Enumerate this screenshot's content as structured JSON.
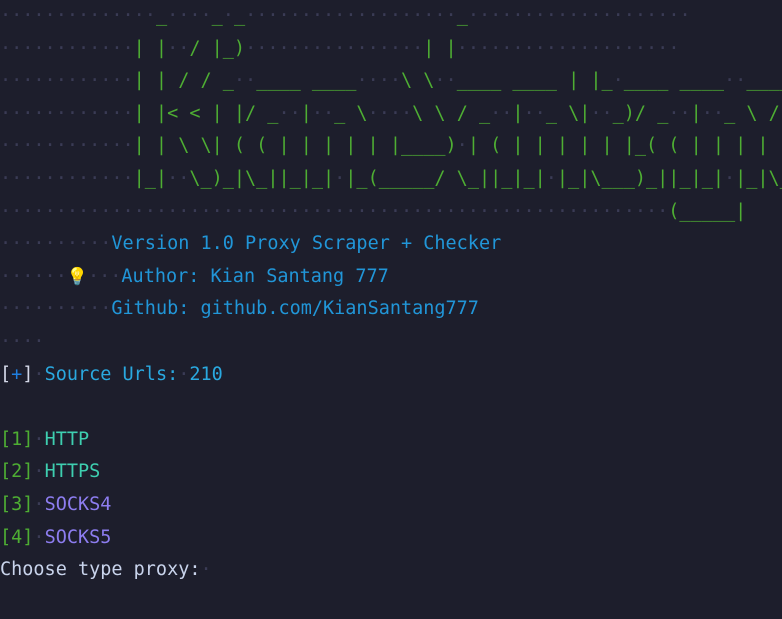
{
  "terminal": {
    "background_color": "#1d1e2c",
    "whitespace_dot_color": "#3a3b55",
    "ascii_art_color": "#4eae33",
    "info_color": "#2196d8",
    "banner": {
      "name": "Kr Proxy Scraper figlet banner",
      "rows": [
        "               _      _ _                    _",
        "              | |  / |_)                    | |",
        "              | | / / _  ____ ____    \\ \\  ____ ____ | |_  ____ ____   ____",
        "              | |< < | |/ _  |  _ \\    \\ \\ / _  |  _ \\|  _)/ _  |  _ \\ / _  |",
        "              | | \\ \\| ( ( | | | | |____) | ( | | | | | |_( ( | | | | ( ( | |",
        "              |_|  \\_)_|\\_||_|_| |_(_____/ \\_||_|_| |_|\\___)_||_|_| |_|\\_|| |",
        "                                                                   (_____|"
      ]
    },
    "lines": [
      {
        "id": "version",
        "indent": 12,
        "text": "Version 1.0 Proxy Scraper + Checker",
        "color": "info"
      },
      {
        "id": "author",
        "indent": 12,
        "text": "Author: Kian Santang 777",
        "color": "info",
        "emoji": "💡",
        "emoji_name": "lightbulb-icon"
      },
      {
        "id": "github",
        "indent": 12,
        "text": "Github: github.com/KianSantang777",
        "color": "info"
      }
    ],
    "source_urls": {
      "bracket_open": "[",
      "marker": "+",
      "bracket_close": "]",
      "label": "Source Urls:",
      "count": "210"
    },
    "menu": {
      "items": [
        {
          "key": "1",
          "label": "HTTP",
          "color": "teal"
        },
        {
          "key": "2",
          "label": "HTTPS",
          "color": "teal"
        },
        {
          "key": "3",
          "label": "SOCKS4",
          "color": "purple"
        },
        {
          "key": "4",
          "label": "SOCKS5",
          "color": "purple"
        }
      ]
    },
    "prompt": {
      "text": "Choose type proxy:"
    }
  }
}
